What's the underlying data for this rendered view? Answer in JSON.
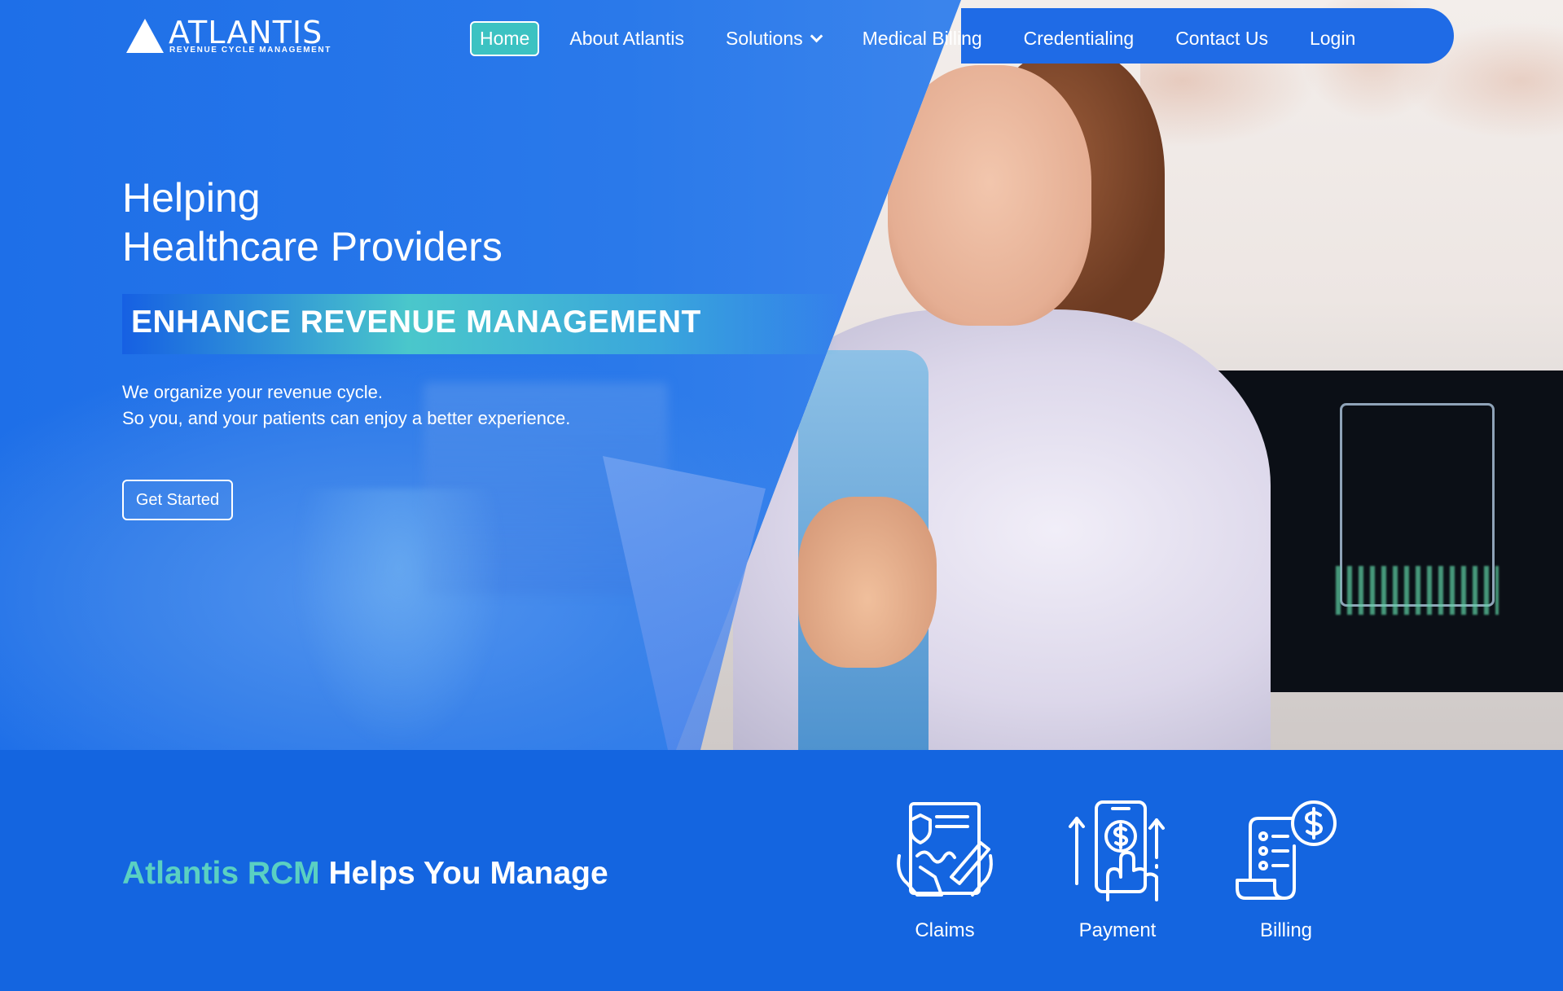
{
  "brand": {
    "name": "ATLANTIS",
    "tagline": "REVENUE CYCLE MANAGEMENT"
  },
  "nav": {
    "items": [
      {
        "label": "Home",
        "active": true
      },
      {
        "label": "About Atlantis"
      },
      {
        "label": "Solutions",
        "has_dropdown": true
      },
      {
        "label": "Medical Billing"
      },
      {
        "label": "Credentialing"
      },
      {
        "label": "Contact Us"
      },
      {
        "label": "Login"
      }
    ]
  },
  "hero": {
    "title_line1": "Helping",
    "title_line2": "Healthcare Providers",
    "banner": "ENHANCE REVENUE MANAGEMENT",
    "desc_line1": "We organize your revenue cycle.",
    "desc_line2": "So you, and your patients can enjoy a better experience.",
    "cta": "Get Started"
  },
  "manage": {
    "heading_accent": "Atlantis RCM",
    "heading_rest": " Helps You Manage",
    "features": [
      {
        "label": "Claims",
        "icon": "claims-icon"
      },
      {
        "label": "Payment",
        "icon": "payment-icon"
      },
      {
        "label": "Billing",
        "icon": "billing-icon"
      }
    ]
  },
  "colors": {
    "primary_blue": "#1465e0",
    "accent_teal": "#5ad0c2",
    "active_nav": "#3cc2c2"
  }
}
